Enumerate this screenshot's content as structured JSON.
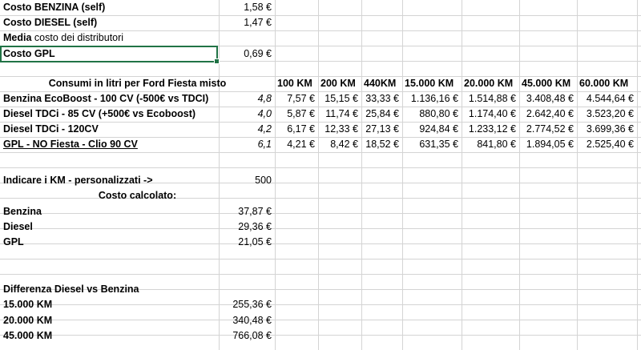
{
  "prices": [
    {
      "label": "Costo BENZINA (self)",
      "value": "1,58 €"
    },
    {
      "label": "Costo DIESEL (self)",
      "value": "1,47 €"
    }
  ],
  "media_bold": "Media",
  "media_rest": " costo dei distributori",
  "gpl_price": {
    "label": "Costo GPL",
    "value": "0,69 €"
  },
  "table_title": "Consumi in litri per Ford Fiesta misto",
  "km_headers": [
    "100 KM",
    "200 KM",
    "440KM",
    "15.000 KM",
    "20.000 KM",
    "45.000 KM",
    "60.000 KM"
  ],
  "cars": [
    {
      "name": "Benzina EcoBoost - 100 CV (-500€ vs TDCI)",
      "consumption": "4,8",
      "costs": [
        "7,57 €",
        "15,15 €",
        "33,33 €",
        "1.136,16 €",
        "1.514,88 €",
        "3.408,48 €",
        "4.544,64 €"
      ]
    },
    {
      "name": "Diesel TDCi - 85 CV (+500€ vs Ecoboost)",
      "consumption": "4,0",
      "costs": [
        "5,87 €",
        "11,74 €",
        "25,84 €",
        "880,80 €",
        "1.174,40 €",
        "2.642,40 €",
        "3.523,20 €"
      ]
    },
    {
      "name": "Diesel TDCi - 120CV",
      "consumption": "4,2",
      "costs": [
        "6,17 €",
        "12,33 €",
        "27,13 €",
        "924,84 €",
        "1.233,12 €",
        "2.774,52 €",
        "3.699,36 €"
      ]
    },
    {
      "name": "GPL - NO Fiesta - Clio 90 CV",
      "consumption": "6,1",
      "costs": [
        "4,21 €",
        "8,42 €",
        "18,52 €",
        "631,35 €",
        "841,80 €",
        "1.894,05 €",
        "2.525,40 €"
      ]
    }
  ],
  "custom_km": {
    "label": "Indicare i KM - personalizzati ->",
    "value": "500"
  },
  "calc_title": "Costo calcolato:",
  "calc": [
    {
      "label": "Benzina",
      "value": "37,87 €"
    },
    {
      "label": "Diesel",
      "value": "29,36 €"
    },
    {
      "label": "GPL",
      "value": "21,05 €"
    }
  ],
  "diff_title": "Differenza Diesel vs Benzina",
  "diff": [
    {
      "label": "15.000 KM",
      "value": "255,36 €"
    },
    {
      "label": "20.000 KM",
      "value": "340,48 €"
    },
    {
      "label": "45.000 KM",
      "value": "766,08 €"
    }
  ]
}
